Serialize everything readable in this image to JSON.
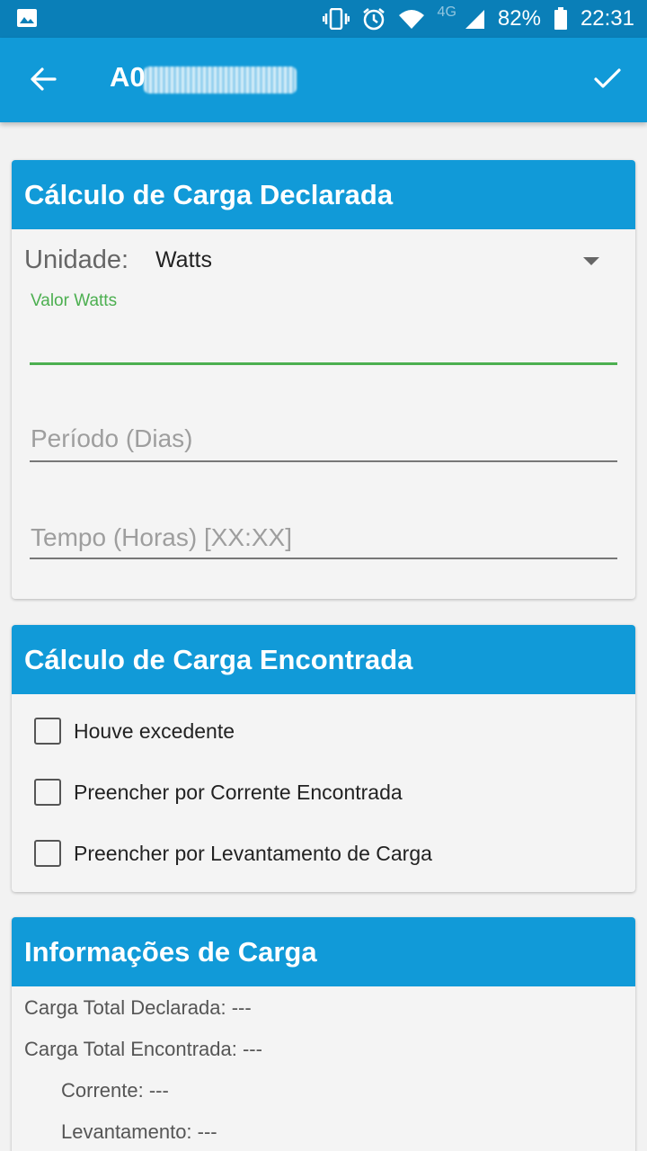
{
  "status_bar": {
    "battery": "82%",
    "time": "22:31",
    "network": "4G",
    "icons": [
      "image-icon",
      "vibrate-icon",
      "alarm-icon",
      "wifi-icon",
      "signal-icon",
      "battery-icon"
    ]
  },
  "app_bar": {
    "title": "A0",
    "back_icon": "arrow-back-icon",
    "confirm_icon": "check-icon"
  },
  "card_declarada": {
    "title": "Cálculo de Carga Declarada",
    "unit_label": "Unidade:",
    "unit_value": "Watts",
    "valor_label": "Valor Watts",
    "valor_value": "",
    "periodo_placeholder": "Período (Dias)",
    "tempo_placeholder": "Tempo (Horas) [XX:XX]"
  },
  "card_encontrada": {
    "title": "Cálculo de Carga Encontrada",
    "options": [
      {
        "label": "Houve excedente",
        "checked": false
      },
      {
        "label": "Preencher por Corrente Encontrada",
        "checked": false
      },
      {
        "label": "Preencher por Levantamento de Carga",
        "checked": false
      }
    ]
  },
  "card_info": {
    "title": "Informações de Carga",
    "lines": [
      "Carga Total Declarada: ---",
      "Carga Total Encontrada: ---",
      "Corrente: ---",
      "Levantamento: ---"
    ]
  },
  "colors": {
    "status_bar": "#0a7fb8",
    "primary": "#119ad8",
    "accent": "#4caf50",
    "background": "#f2f2f2"
  }
}
